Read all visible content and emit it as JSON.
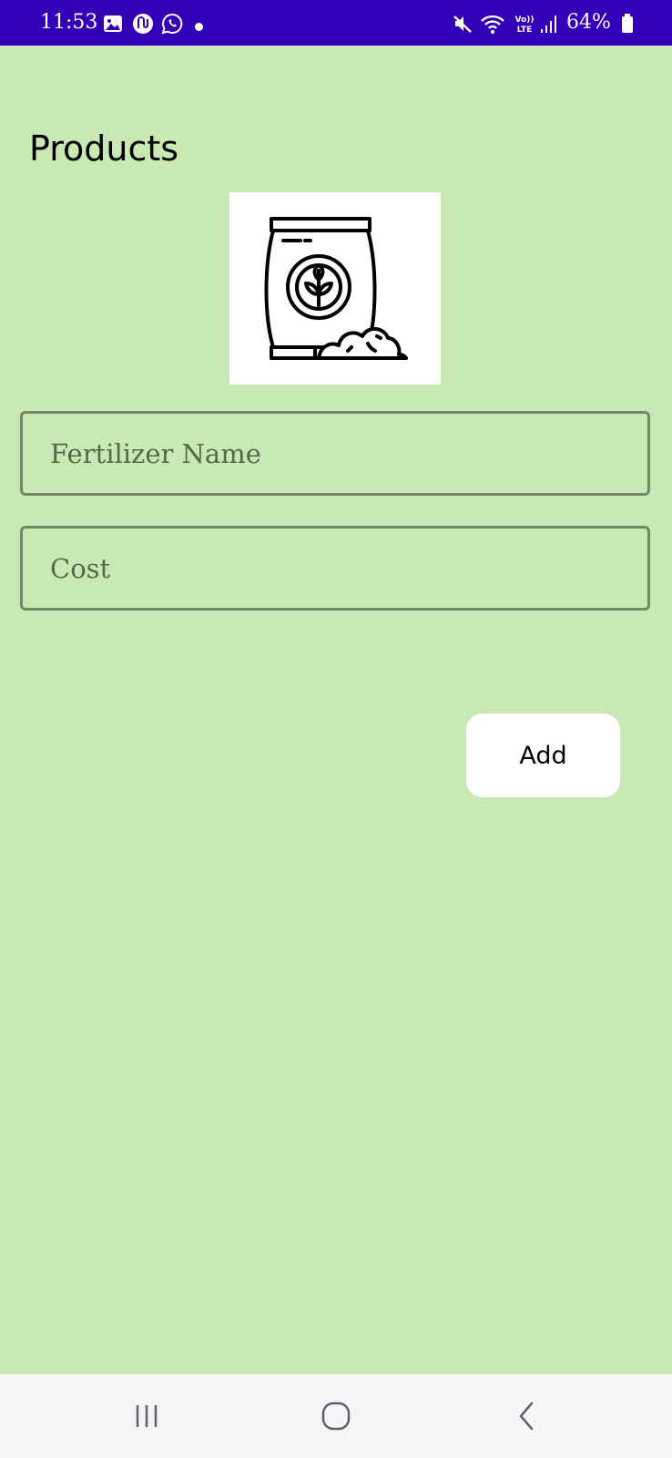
{
  "status_bar": {
    "time": "11:53",
    "battery": "64%",
    "background_color": "#3300b8",
    "icons": [
      "gallery-icon",
      "app-icon",
      "whatsapp-icon",
      "notification-dot",
      "mute-icon",
      "wifi-icon",
      "volte-lte-icon",
      "signal-icon",
      "battery-icon"
    ]
  },
  "page": {
    "title": "Products",
    "background_color": "#c8e9b3",
    "image_icon": "fertilizer-bag-icon"
  },
  "form": {
    "fertilizer_name_placeholder": "Fertilizer Name",
    "cost_placeholder": "Cost",
    "add_label": "Add"
  },
  "nav_bar": {
    "icons": [
      "recent-apps-icon",
      "home-icon",
      "back-icon"
    ]
  }
}
